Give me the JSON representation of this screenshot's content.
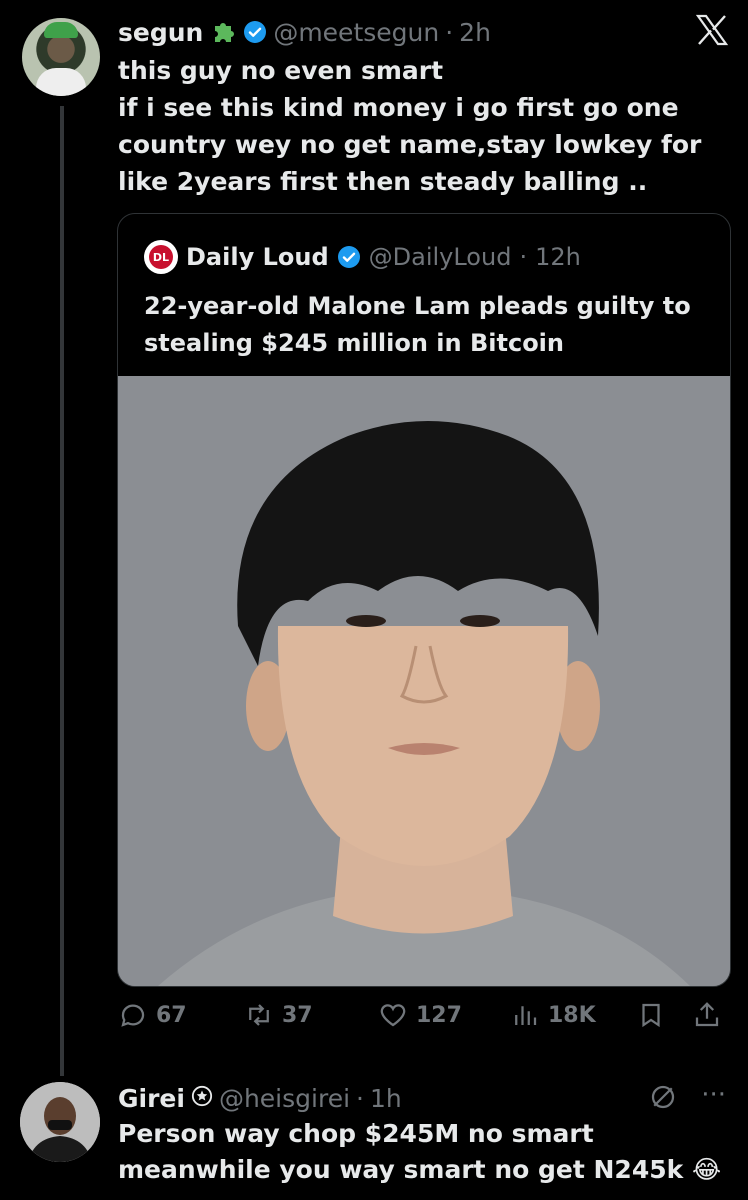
{
  "tweet": {
    "author_name": "segun",
    "handle": "@meetsegun",
    "separator": "·",
    "time": "2h",
    "text": "this guy no even smart\nif i see this kind money i go first go one country wey no get name,stay lowkey for like 2years first then steady balling ..",
    "quoted": {
      "author_name": "Daily Loud",
      "handle": "@DailyLoud",
      "separator": "·",
      "time": "12h",
      "text": "22-year-old Malone Lam pleads guilty to stealing $245 million in Bitcoin"
    },
    "actions": {
      "replies": "67",
      "reposts": "37",
      "likes": "127",
      "views": "18K"
    }
  },
  "reply": {
    "author_name": "Girei",
    "handle": "@heisgirei",
    "separator": "·",
    "time": "1h",
    "text": "Person way chop $245M no smart\nmeanwhile you way smart no get N245k 😂",
    "more": "···"
  },
  "icons": {
    "platform": "x-logo-icon",
    "verified": "verified-badge-icon",
    "accent": "#1d9bf0"
  }
}
